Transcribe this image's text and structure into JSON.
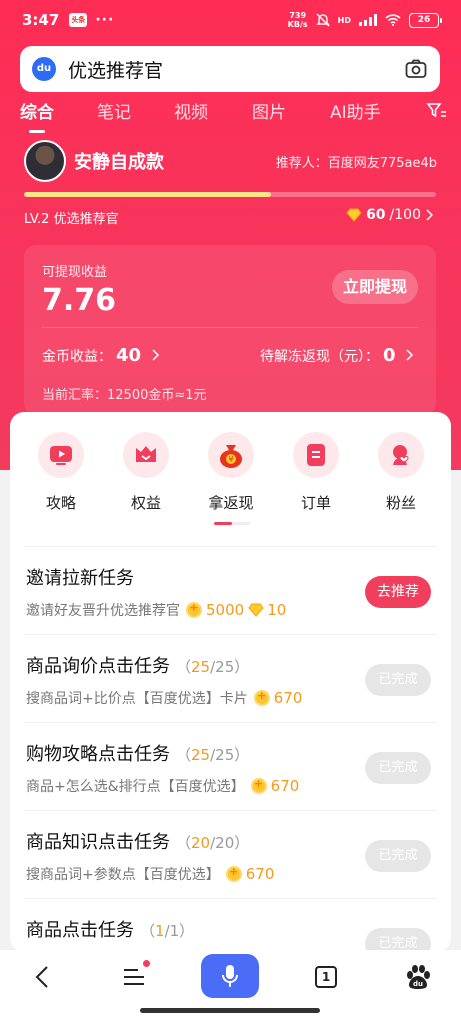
{
  "status_bar": {
    "time": "3:47",
    "app_badge": "头条",
    "dots": "···",
    "net_speed_value": "739",
    "net_speed_unit": "KB/s",
    "network": "HD",
    "battery": "26"
  },
  "search": {
    "logo_text": "du",
    "query": "优选推荐官"
  },
  "tabs": [
    "综合",
    "笔记",
    "视频",
    "图片",
    "AI助手"
  ],
  "profile": {
    "name": "安静自成款",
    "recommender": "推荐人：百度网友775ae4b",
    "level": "LV.2 优选推荐官",
    "points_current": "60",
    "points_total": "/100",
    "progress": 0.6
  },
  "earnings": {
    "label": "可提现收益",
    "value": "7.76",
    "withdraw_button": "立即提现",
    "coin_label": "金币收益：",
    "coin_value": "40",
    "pending_label": "待解冻返现（元）：",
    "pending_value": "0",
    "rate": "当前汇率：12500金币≈1元"
  },
  "categories": [
    {
      "label": "攻略",
      "icon": "play-icon"
    },
    {
      "label": "权益",
      "icon": "gift-icon"
    },
    {
      "label": "拿返现",
      "icon": "money-bag-icon"
    },
    {
      "label": "订单",
      "icon": "order-icon"
    },
    {
      "label": "粉丝",
      "icon": "fans-icon"
    }
  ],
  "tasks": [
    {
      "title": "邀请拉新任务",
      "desc": "邀请好友晋升优选推荐官",
      "reward_coin": "5000",
      "reward_gem": "10",
      "button": "去推荐"
    },
    {
      "title": "商品询价点击任务",
      "progress_done": "25",
      "progress_total": "/25",
      "desc": "搜商品词+比价点【百度优选】卡片",
      "reward_coin": "670",
      "button": "已完成"
    },
    {
      "title": "购物攻略点击任务",
      "progress_done": "25",
      "progress_total": "/25",
      "desc": "商品+怎么选&排行点【百度优选】",
      "reward_coin": "670",
      "button": "已完成"
    },
    {
      "title": "商品知识点击任务",
      "progress_done": "20",
      "progress_total": "/20",
      "desc": "搜商品词+参数点【百度优选】",
      "reward_coin": "670",
      "button": "已完成"
    },
    {
      "title": "商品点击任务",
      "progress_done": "1",
      "progress_total": "/1",
      "button": "已完成"
    }
  ],
  "bottom_nav": {
    "tab_count": "1"
  },
  "colors": {
    "brand_red": "#f23e5d",
    "coin_orange": "#f59a1b",
    "mic_blue": "#4a6cf7"
  }
}
